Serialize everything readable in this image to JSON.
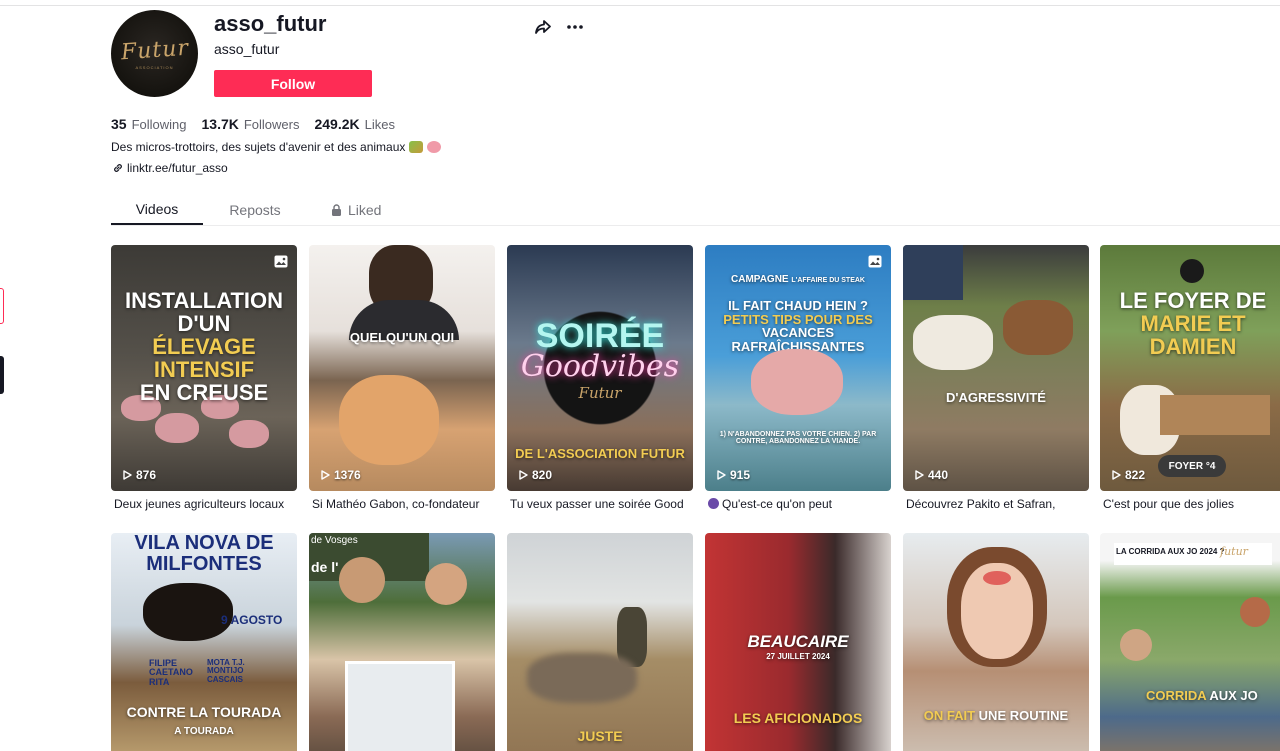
{
  "profile": {
    "username": "asso_futur",
    "nickname": "asso_futur",
    "avatar_text": "Futur",
    "avatar_sub": "ASSOCIATION",
    "follow_label": "Follow",
    "stats": {
      "following_count": "35",
      "following_label": "Following",
      "followers_count": "13.7K",
      "followers_label": "Followers",
      "likes_count": "249.2K",
      "likes_label": "Likes"
    },
    "bio": "Des micros-trottoirs, des sujets d'avenir et des animaux",
    "link": "linktr.ee/futur_asso"
  },
  "tabs": [
    {
      "label": "Videos"
    },
    {
      "label": "Reposts"
    },
    {
      "label": "Liked"
    }
  ],
  "videos": [
    {
      "overlay_white_1": "INSTALLATION D'UN",
      "overlay_yellow": "ÉLEVAGE INTENSIF",
      "overlay_white_2": "EN CREUSE",
      "views": "876",
      "caption": "Deux jeunes agriculteurs locaux"
    },
    {
      "overlay_white_1": "QUELQU'UN QUI",
      "views": "1376",
      "caption": "Si Mathéo Gabon, co-fondateur"
    },
    {
      "overlay_white_1": "SOIRÉE",
      "overlay_script": "Goodvibes",
      "overlay_brand": "Futur",
      "overlay_yellow": "DE L'ASSOCIATION FUTUR",
      "views": "820",
      "caption": "Tu veux passer une soirée Good"
    },
    {
      "overlay_top_1": "CAMPAGNE",
      "overlay_top_2": "L'AFFAIRE DU STEAK",
      "overlay_white_1": "IL FAIT CHAUD HEIN ?",
      "overlay_yellow": "PETITS TIPS POUR DES",
      "overlay_white_2": "VACANCES RAFRAÎCHISSANTES",
      "overlay_small": "1) N'ABANDONNEZ PAS VOTRE CHIEN. 2) PAR CONTRE, ABANDONNEZ LA VIANDE.",
      "views": "915",
      "caption": "Qu'est-ce qu'on peut"
    },
    {
      "overlay_white_1": "D'AGRESSIVITÉ",
      "views": "440",
      "caption": "Découvrez Pakito et Safran,"
    },
    {
      "overlay_white_1": "LE FOYER DE",
      "overlay_yellow": "MARIE ET DAMIEN",
      "overlay_badge": "FOYER °4",
      "views": "822",
      "caption": "C'est pour que des jolies"
    },
    {
      "overlay_blue": "VILA NOVA DE MILFONTES",
      "overlay_date": "9 AGOSTO",
      "overlay_names": "FILIPE CAETANO RITA",
      "overlay_names_2": "MOTA T.J. MONTIJO CASCAIS",
      "overlay_white_1": "CONTRE LA TOURADA",
      "overlay_bottom": "A TOURADA"
    },
    {
      "overlay_white_1": "de Vosges",
      "overlay_white_2": "de l'"
    },
    {
      "overlay_white_1": "JUSTE"
    },
    {
      "overlay_white_1": "BEAUCAIRE",
      "overlay_date": "27 JUILLET 2024",
      "overlay_yellow": "LES AFICIONADOS"
    },
    {
      "overlay_yellow": "ON FAIT",
      "overlay_white_1": "UNE ROUTINE"
    },
    {
      "overlay_top_1": "LA CORRIDA AUX JO 2024 ?",
      "overlay_brand": "futur",
      "overlay_yellow": "CORRIDA",
      "overlay_white_1": "AUX JO"
    }
  ],
  "colors": {
    "accent": "#fe2c55",
    "yellow_overlay": "#f2cc52",
    "text": "#161823",
    "muted": "#73747b"
  }
}
